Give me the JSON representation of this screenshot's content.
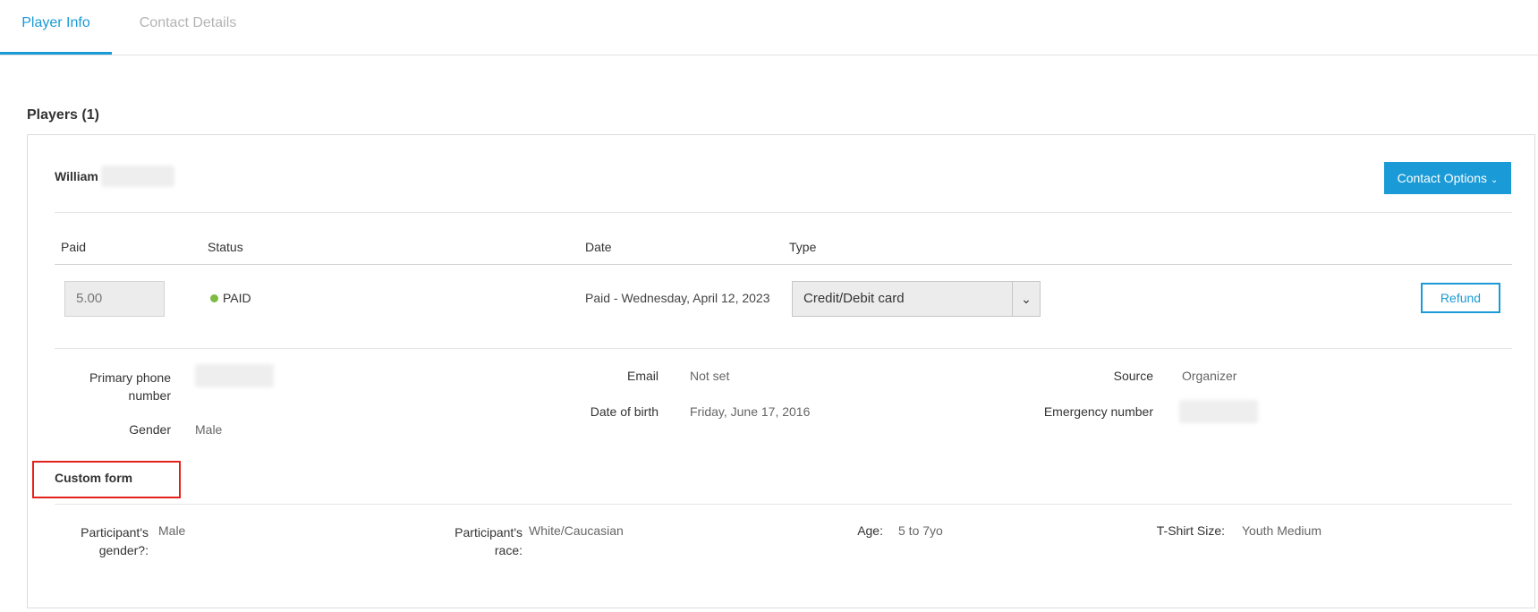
{
  "tabs": [
    {
      "label": "Player Info",
      "active": true
    },
    {
      "label": "Contact Details",
      "active": false
    }
  ],
  "players_section": {
    "title": "Players (1)"
  },
  "player": {
    "first_name": "William",
    "contact_options_label": "Contact Options",
    "payment_table": {
      "headers": {
        "paid": "Paid",
        "status": "Status",
        "date": "Date",
        "type": "Type"
      },
      "row": {
        "amount": "5.00",
        "status": "PAID",
        "status_color": "#7dbb42",
        "date": "Paid - Wednesday, April 12, 2023",
        "type": "Credit/Debit card",
        "refund_label": "Refund"
      }
    },
    "details": {
      "primary_phone_label": "Primary phone number",
      "gender_label": "Gender",
      "gender_value": "Male",
      "email_label": "Email",
      "email_value": "Not set",
      "dob_label": "Date of birth",
      "dob_value": "Friday, June 17, 2016",
      "source_label": "Source",
      "source_value": "Organizer",
      "emergency_label": "Emergency number"
    },
    "custom_form": {
      "title": "Custom form",
      "fields": [
        {
          "label": "Participant's gender?:",
          "value": "Male"
        },
        {
          "label": "Participant's race:",
          "value": "White/Caucasian"
        },
        {
          "label": "Age:",
          "value": "5 to 7yo"
        },
        {
          "label": "T-Shirt Size:",
          "value": "Youth Medium"
        }
      ]
    }
  },
  "colors": {
    "accent": "#1a9ad6",
    "highlight_box": "#e3221b"
  },
  "icons": {
    "contact_options_chevron": "chevron-down-icon",
    "select_chevron": "chevron-down-icon"
  }
}
